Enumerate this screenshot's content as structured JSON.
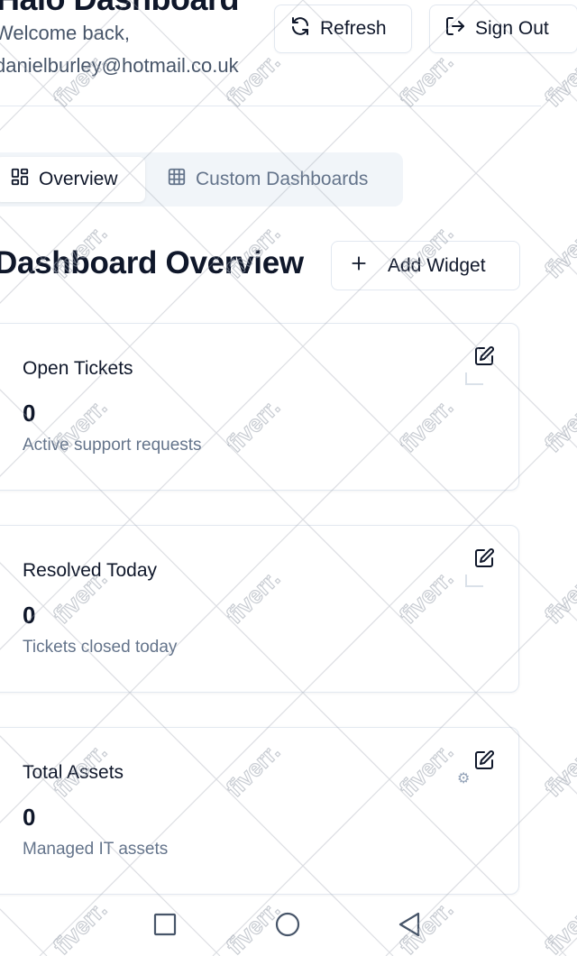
{
  "header": {
    "app_title": "Halo Dashboard",
    "welcome": "Welcome back,",
    "email": "danielburley@hotmail.co.uk",
    "refresh_label": "Refresh",
    "signout_label": "Sign Out"
  },
  "tabs": [
    {
      "label": "Overview",
      "icon": "layout-grid-icon",
      "active": true
    },
    {
      "label": "Custom Dashboards",
      "icon": "table-grid-icon",
      "active": false
    }
  ],
  "section": {
    "title": "Dashboard Overview",
    "add_widget_label": "Add Widget"
  },
  "cards": [
    {
      "title": "Open Tickets",
      "value": "0",
      "description": "Active support requests"
    },
    {
      "title": "Resolved Today",
      "value": "0",
      "description": "Tickets closed today"
    },
    {
      "title": "Total Assets",
      "value": "0",
      "description": "Managed IT assets"
    }
  ],
  "watermark": "fiverr.",
  "colors": {
    "text_primary": "#0f172a",
    "text_muted": "#64748b",
    "border": "#e2e8f0",
    "tab_track": "#f1f5f9"
  },
  "navbar": {
    "icons": [
      "recents-square-icon",
      "home-circle-icon",
      "back-triangle-icon"
    ]
  }
}
